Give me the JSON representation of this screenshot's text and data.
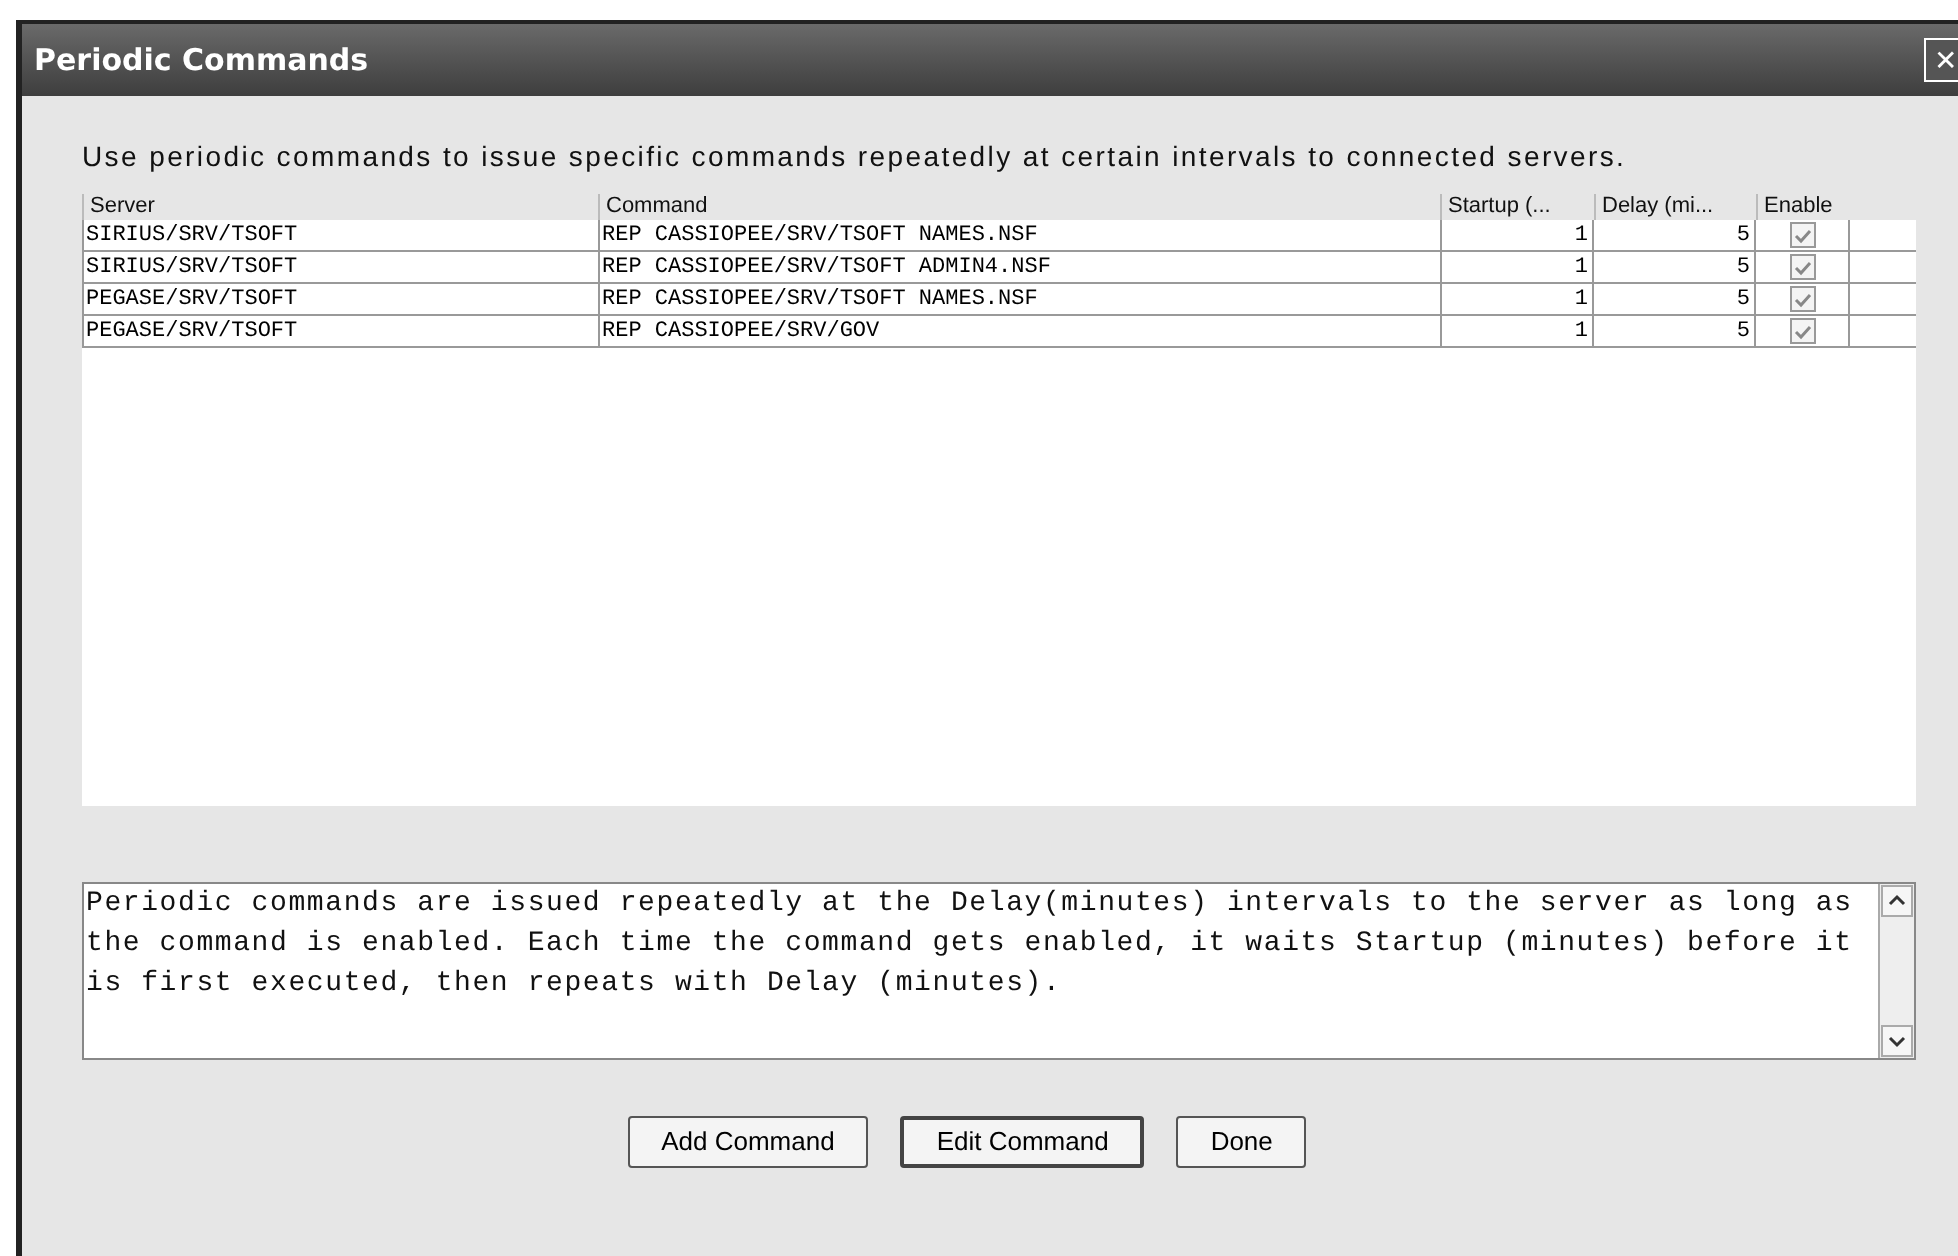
{
  "window": {
    "title": "Periodic Commands",
    "close": "✕"
  },
  "intro": "Use periodic commands to issue specific commands repeatedly at certain intervals to connected servers.",
  "table": {
    "columns": [
      "Server",
      "Command",
      "Startup (...",
      "Delay (mi...",
      "Enable"
    ],
    "rows": [
      {
        "server": "SIRIUS/SRV/TSOFT",
        "command": "REP CASSIOPEE/SRV/TSOFT NAMES.NSF",
        "startup": "1",
        "delay": "5",
        "enabled": true,
        "selected": false
      },
      {
        "server": "SIRIUS/SRV/TSOFT",
        "command": "REP CASSIOPEE/SRV/TSOFT ADMIN4.NSF",
        "startup": "1",
        "delay": "5",
        "enabled": true,
        "selected": false
      },
      {
        "server": "PEGASE/SRV/TSOFT",
        "command": "REP CASSIOPEE/SRV/TSOFT NAMES.NSF",
        "startup": "1",
        "delay": "5",
        "enabled": true,
        "selected": false
      },
      {
        "server": "PEGASE/SRV/TSOFT",
        "command": "REP CASSIOPEE/SRV/GOV",
        "startup": "1",
        "delay": "5",
        "enabled": true,
        "selected": false
      }
    ]
  },
  "description": "Periodic commands are issued repeatedly at the Delay(minutes) intervals to the server as long as the command is enabled. Each time the command gets enabled, it waits Startup (minutes) before it is first executed, then repeats with Delay (minutes).",
  "buttons": [
    {
      "label": "Add Command",
      "default": false
    },
    {
      "label": "Edit Command",
      "default": true
    },
    {
      "label": "Done",
      "default": false
    }
  ]
}
